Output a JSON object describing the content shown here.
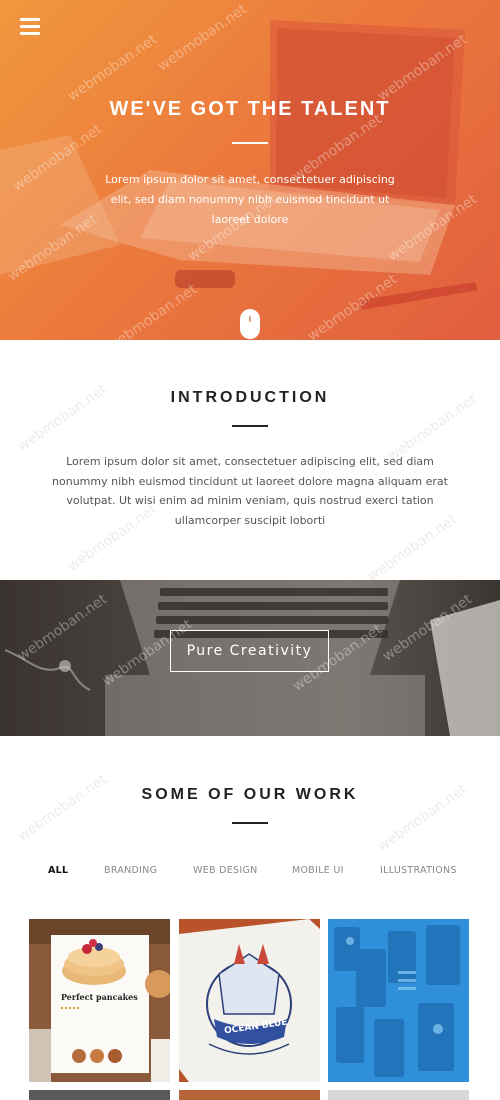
{
  "hero": {
    "title": "WE'VE GOT THE TALENT",
    "text": "Lorem ipsum dolor sit amet, consectetuer adipiscing elit, sed diam nonummy nibh euismod tincidunt ut laoreet dolore"
  },
  "intro": {
    "title": "INTRODUCTION",
    "text": "Lorem ipsum dolor sit amet, consectetuer adipiscing elit, sed diam nonummy nibh euismod tincidunt ut laoreet dolore magna aliquam erat volutpat. Ut wisi enim ad minim veniam, quis nostrud exerci tation ullamcorper suscipit loborti"
  },
  "banner": {
    "button_label": "Pure Creativity"
  },
  "work": {
    "title": "SOME OF OUR WORK",
    "filters": [
      "ALL",
      "BRANDING",
      "WEB DESIGN",
      "MOBILE UI",
      "ILLUSTRATIONS"
    ],
    "active_filter": "ALL",
    "items": [
      {
        "caption": "Perfect pancakes"
      },
      {
        "caption": "OCEAN BLUE"
      },
      {
        "caption": ""
      }
    ]
  },
  "watermark": "webmoban.net",
  "colors": {
    "hero_start": "#f0983d",
    "hero_end": "#e05e3e",
    "accent_blue": "#2f8fd8"
  }
}
